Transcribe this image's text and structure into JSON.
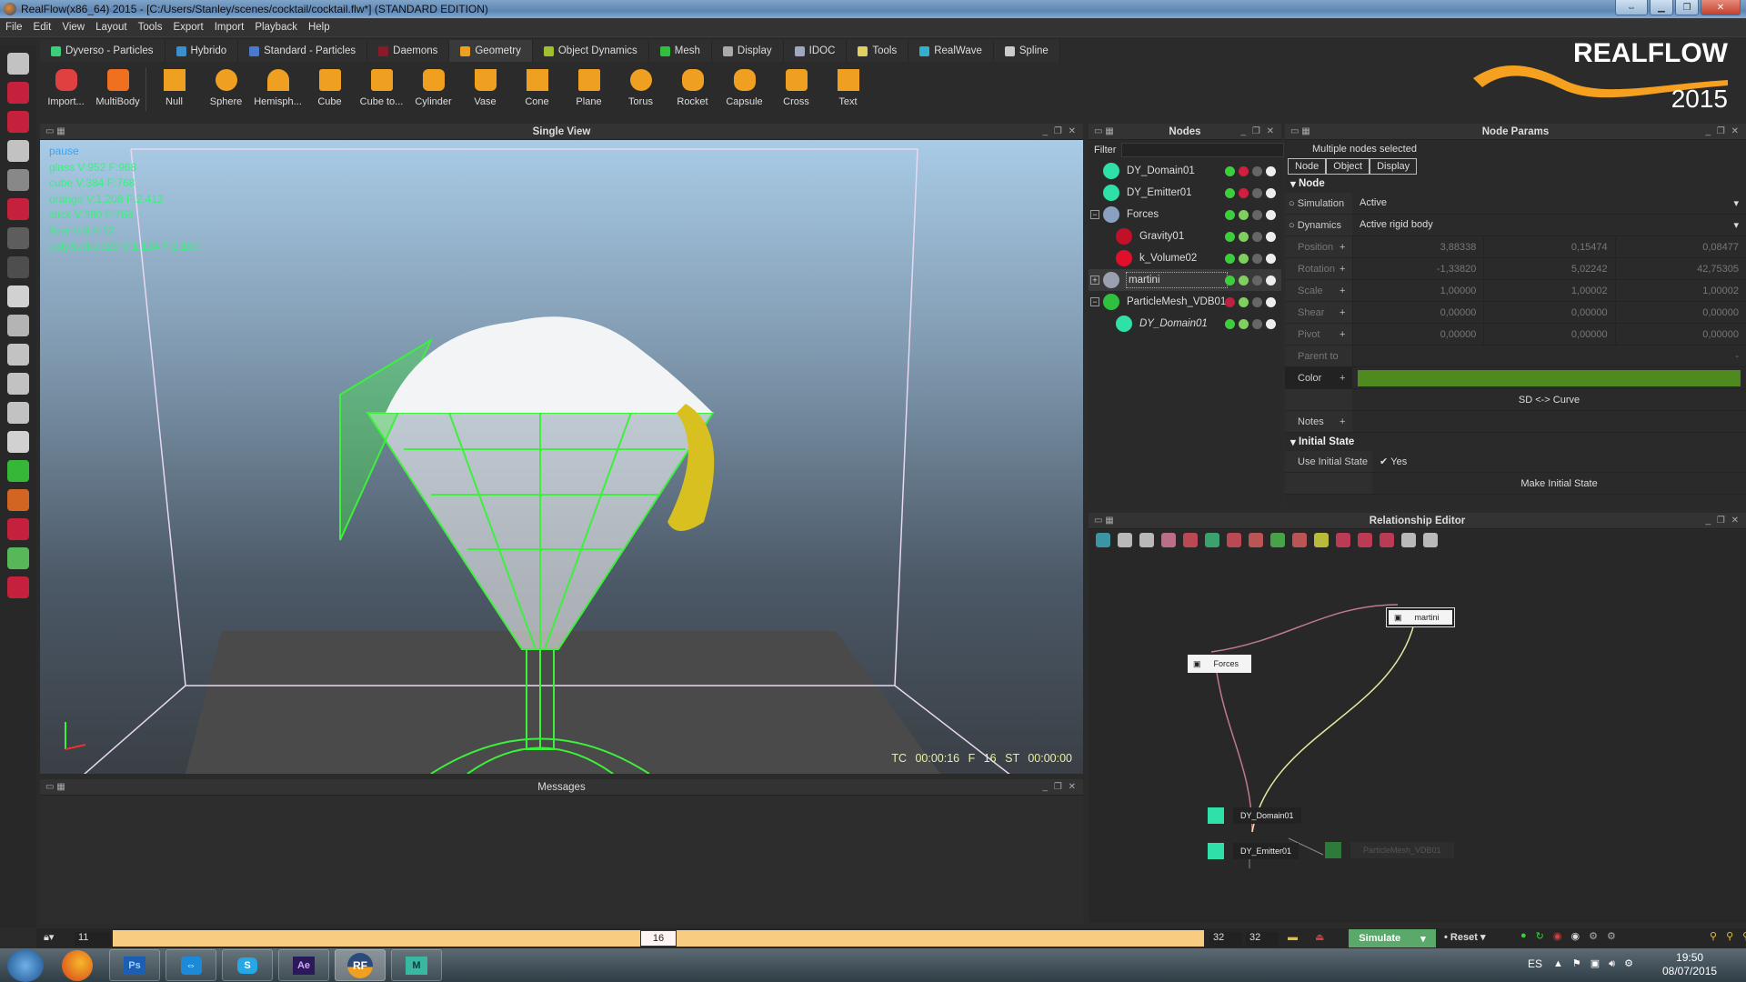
{
  "window": {
    "title": "RealFlow(x86_64) 2015 - [C:/Users/Stanley/scenes/cocktail/cocktail.flw*] (STANDARD EDITION)",
    "buttons": [
      "resize",
      "minimize",
      "maximize",
      "close"
    ]
  },
  "menu": [
    "File",
    "Edit",
    "View",
    "Layout",
    "Tools",
    "Export",
    "Import",
    "Playback",
    "Help"
  ],
  "shelf_tabs": [
    {
      "label": "Dyverso - Particles",
      "color": "#3ad07a"
    },
    {
      "label": "Hybrido",
      "color": "#3a8fd0"
    },
    {
      "label": "Standard - Particles",
      "color": "#4a7ad0"
    },
    {
      "label": "Daemons",
      "color": "#8a1a2a"
    },
    {
      "label": "Geometry",
      "color": "#f0a020",
      "active": true
    },
    {
      "label": "Object Dynamics",
      "color": "#a0c030"
    },
    {
      "label": "Mesh",
      "color": "#30c040"
    },
    {
      "label": "Display",
      "color": "#aaaaaa"
    },
    {
      "label": "IDOC",
      "color": "#a0a8c0"
    },
    {
      "label": "Tools",
      "color": "#e0d060"
    },
    {
      "label": "RealWave",
      "color": "#30b0d0"
    },
    {
      "label": "Spline",
      "color": "#cccccc"
    }
  ],
  "shelf_tools": [
    "Import...",
    "MultiBody",
    "Null",
    "Sphere",
    "Hemisph...",
    "Cube",
    "Cube to...",
    "Cylinder",
    "Vase",
    "Cone",
    "Plane",
    "Torus",
    "Rocket",
    "Capsule",
    "Cross",
    "Text"
  ],
  "logo": {
    "brand": "REALFLOW",
    "year": "2015",
    "accent": "#f5a01e"
  },
  "left_toolbar": [
    "select",
    "move",
    "rotate",
    "scale",
    "layout",
    "pack",
    "pencil",
    "joystick",
    "solid-box",
    "dotted-box",
    "wire-box",
    "wire-sphere",
    "shaded-sphere",
    "flat-sphere",
    "green-brush",
    "orange-brush",
    "red-brush",
    "save-green",
    "save-red"
  ],
  "viewport": {
    "title": "Single View",
    "stats": [
      "pause",
      "glass V:952 F:968",
      "cube V:384 F:768",
      "orange V:1,208 F:2,412",
      "stick V:380 F:768",
      "floor V:8 F:12",
      "polySurface29 V:1,124 F:2,160"
    ],
    "hud": {
      "tc": "TC 00:00:16",
      "frame": "F 16",
      "st": "ST 00:00:00"
    }
  },
  "messages": {
    "title": "Messages"
  },
  "nodes": {
    "title": "Nodes",
    "filter_label": "Filter",
    "filter_value": "",
    "items": [
      {
        "name": "DY_Domain01",
        "indent": 0,
        "color": "#2fe0a8"
      },
      {
        "name": "DY_Emitter01",
        "indent": 0,
        "color": "#2fe0a8"
      },
      {
        "name": "Forces",
        "indent": 0,
        "expander": "−",
        "color": "#8aa0c0"
      },
      {
        "name": "Gravity01",
        "indent": 1,
        "color": "#c0102a"
      },
      {
        "name": "k_Volume02",
        "indent": 1,
        "color": "#e0102a"
      },
      {
        "name": "martini",
        "indent": 0,
        "expander": "+",
        "color": "#9aa0b0",
        "selected": true
      },
      {
        "name": "ParticleMesh_VDB01",
        "indent": 0,
        "expander": "−",
        "color": "#30c040"
      },
      {
        "name": "DY_Domain01",
        "indent": 1,
        "color": "#2fe0a8",
        "italic": true
      }
    ]
  },
  "node_params": {
    "title": "Node Params",
    "subtitle": "Multiple nodes selected",
    "tabs": [
      "Node",
      "Object",
      "Display"
    ],
    "section_node": "Node",
    "simulation": {
      "label": "Simulation",
      "value": "Active"
    },
    "dynamics": {
      "label": "Dynamics",
      "value": "Active rigid body"
    },
    "transforms": [
      {
        "label": "Position",
        "values": [
          "3,88338",
          "0,15474",
          "0,08477"
        ]
      },
      {
        "label": "Rotation",
        "values": [
          "-1,33820",
          "5,02242",
          "42,75305"
        ]
      },
      {
        "label": "Scale",
        "values": [
          "1,00000",
          "1,00002",
          "1,00002"
        ]
      },
      {
        "label": "Shear",
        "values": [
          "0,00000",
          "0,00000",
          "0,00000"
        ]
      },
      {
        "label": "Pivot",
        "values": [
          "0,00000",
          "0,00000",
          "0,00000"
        ]
      }
    ],
    "parent_to": {
      "label": "Parent to",
      "value": "-"
    },
    "color": {
      "label": "Color",
      "value": "#4e8a1e"
    },
    "sd_curve": "SD <-> Curve",
    "notes": "Notes",
    "section_initial": "Initial State",
    "use_initial_state": {
      "label": "Use Initial State",
      "value": "Yes",
      "checked": true
    },
    "make_initial_state": "Make Initial State"
  },
  "relationship_editor": {
    "title": "Relationship Editor",
    "nodes": [
      "martini",
      "Forces",
      "DY_Domain01",
      "DY_Emitter01",
      "ParticleMesh_VDB01"
    ]
  },
  "timeline": {
    "start": "11",
    "current": "16",
    "end_a": "32",
    "end_b": "32",
    "range_min": 0,
    "range_max": 32,
    "simulate_label": "Simulate",
    "reset_label": "Reset"
  },
  "taskbar": {
    "apps": [
      "Windows Start",
      "Firefox",
      "Photoshop",
      "TeamViewer",
      "Skype",
      "After Effects",
      "RealFlow",
      "Maya"
    ],
    "lang": "ES",
    "time": "19:50",
    "date": "08/07/2015"
  }
}
